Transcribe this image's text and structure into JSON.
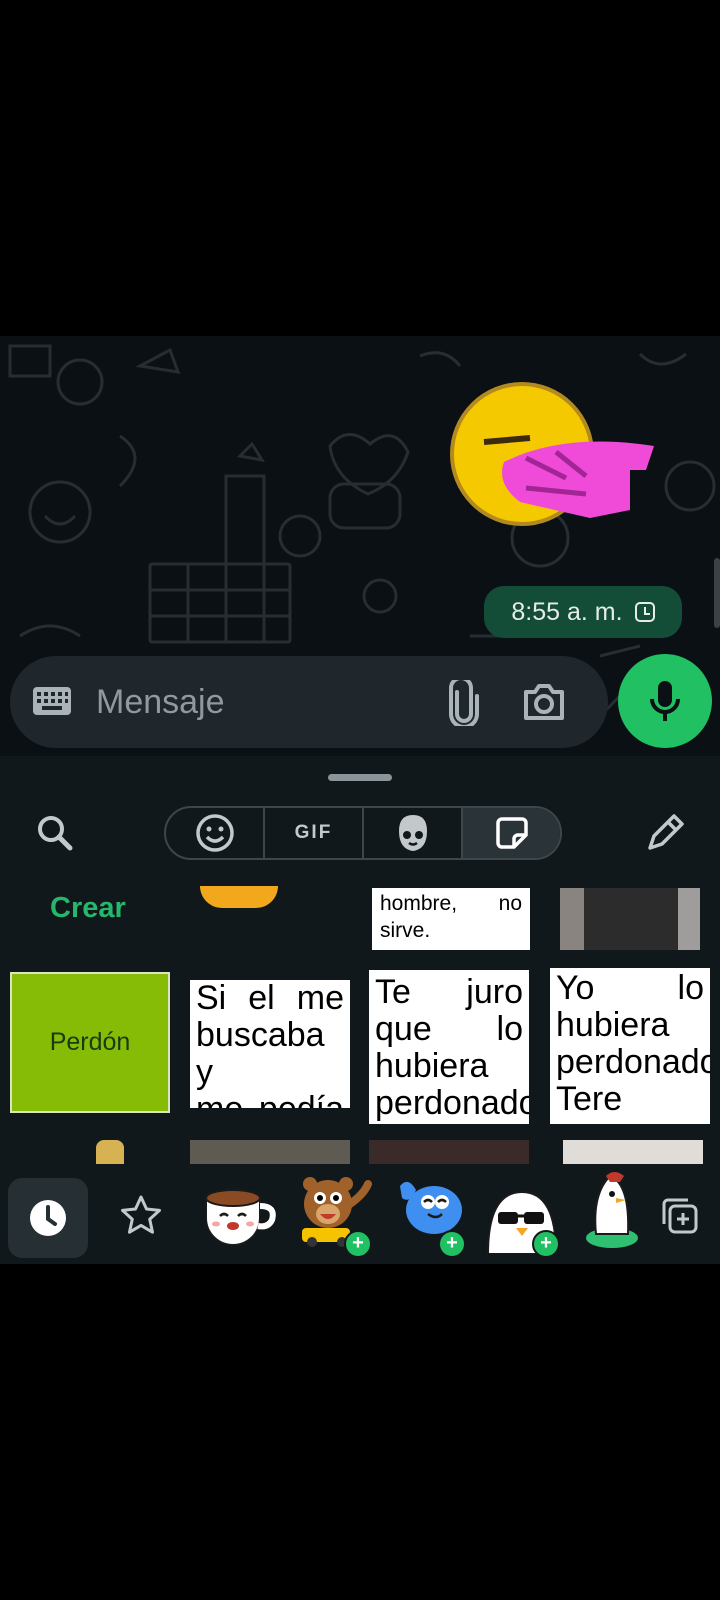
{
  "message": {
    "time": "8:55 a. m.",
    "status_icon": "pending-clock-icon"
  },
  "input": {
    "placeholder": "Mensaje",
    "keyboard_icon": "keyboard-icon",
    "attach_icon": "paperclip-icon",
    "camera_icon": "camera-icon",
    "mic_icon": "microphone-icon"
  },
  "picker": {
    "tabs": [
      {
        "name": "emoji",
        "icon": "smiley-icon"
      },
      {
        "name": "gif",
        "label": "GIF"
      },
      {
        "name": "avatar",
        "icon": "avatar-icon"
      },
      {
        "name": "stickers",
        "icon": "sticker-icon",
        "selected": true
      }
    ],
    "create_label": "Crear",
    "sticker_texts": {
      "top_card": [
        "hombre, no",
        "sirve."
      ],
      "perdon": "Perdón",
      "card1": [
        "Si el me",
        "buscaba y",
        "me pedía"
      ],
      "card2": [
        "Te juro",
        "que lo",
        "hubiera",
        "perdonado"
      ],
      "card3": [
        "Yo lo",
        "hubiera",
        "perdonado",
        "Tere"
      ]
    }
  },
  "tray": {
    "items": [
      "recent-clock-icon",
      "star-icon",
      "coffee-cup-sticker",
      "bear-car-sticker",
      "blue-bird-sticker",
      "white-bird-sunglasses-sticker",
      "penguin-sticker",
      "add-sticker-icon"
    ]
  },
  "colors": {
    "accent_green": "#21c063",
    "bubble_green": "#134d37",
    "background": "#0b1014",
    "panel": "#11181c"
  }
}
